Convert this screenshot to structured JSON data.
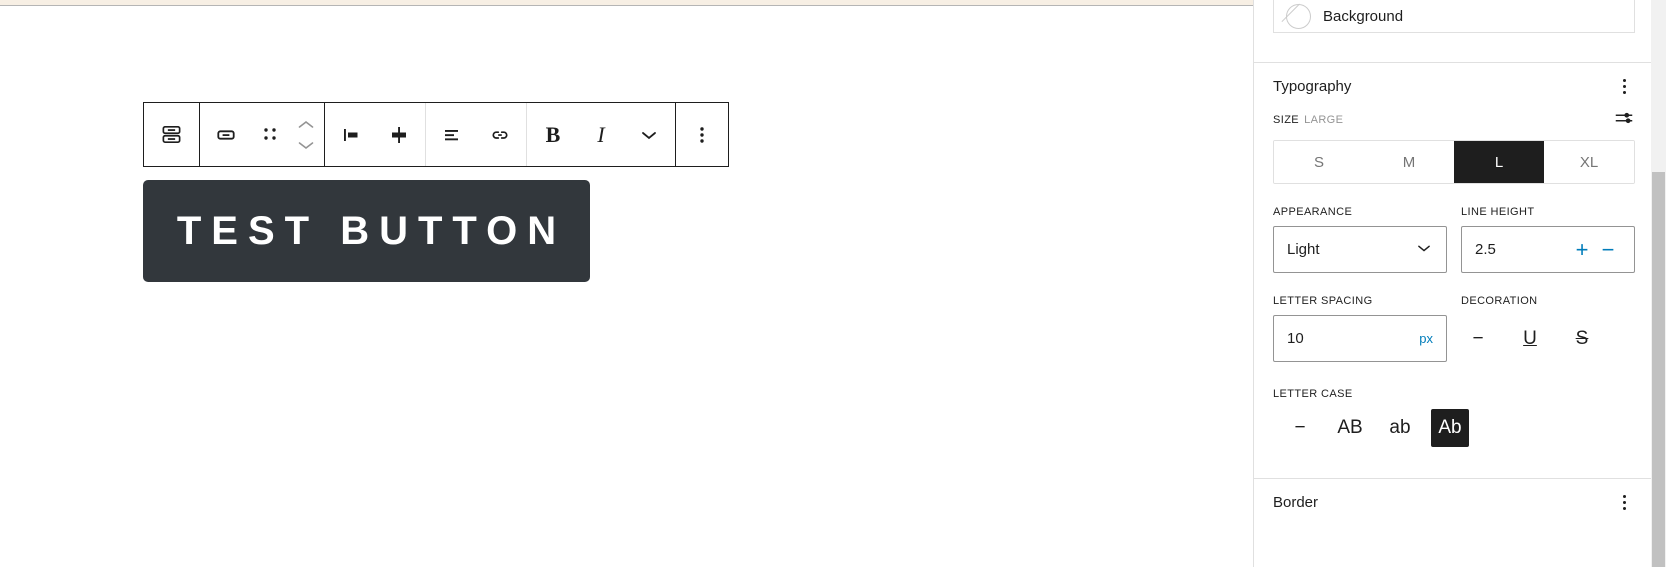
{
  "editor": {
    "block": {
      "text": "TEST BUTTON",
      "background_color": "#32373c",
      "text_color": "#ffffff"
    },
    "toolbar": {
      "block_type_switcher": "Button",
      "buttons": [
        {
          "name": "block-type-switcher",
          "icon": "button-block-icon",
          "label": "Button"
        },
        {
          "name": "select-parent-block",
          "icon": "buttons-block-icon",
          "label": "Select parent block: Buttons"
        },
        {
          "name": "drag-handle",
          "icon": "drag-handle-icon",
          "label": "Drag"
        },
        {
          "name": "move-up",
          "icon": "chevron-up-icon",
          "label": "Move up"
        },
        {
          "name": "move-down",
          "icon": "chevron-down-icon",
          "label": "Move down"
        },
        {
          "name": "align-left",
          "icon": "align-left-icon",
          "label": "Align"
        },
        {
          "name": "width-setting",
          "icon": "width-icon",
          "label": "Width"
        },
        {
          "name": "text-align",
          "icon": "text-align-icon",
          "label": "Align text"
        },
        {
          "name": "insert-link",
          "icon": "link-icon",
          "label": "Link"
        },
        {
          "name": "bold",
          "icon": "bold-icon",
          "label": "B"
        },
        {
          "name": "italic",
          "icon": "italic-icon",
          "label": "I"
        },
        {
          "name": "more-rich-text",
          "icon": "chevron-down-icon",
          "label": "More"
        },
        {
          "name": "block-options",
          "icon": "ellipsis-vertical-icon",
          "label": "Options"
        }
      ]
    }
  },
  "sidebar": {
    "background": {
      "label": "Background",
      "swatch": "none-swatch-icon"
    },
    "typography": {
      "title": "Typography",
      "options_icon": "ellipsis-vertical-icon",
      "size": {
        "label": "SIZE",
        "value_label": "LARGE",
        "custom_icon": "sliders-icon",
        "options": [
          {
            "label": "S",
            "active": false
          },
          {
            "label": "M",
            "active": false
          },
          {
            "label": "L",
            "active": true
          },
          {
            "label": "XL",
            "active": false
          }
        ]
      },
      "appearance": {
        "label": "APPEARANCE",
        "value": "Light",
        "chevron_icon": "chevron-down-icon"
      },
      "line_height": {
        "label": "LINE HEIGHT",
        "value": "2.5",
        "increment_label": "+",
        "decrement_label": "−"
      },
      "letter_spacing": {
        "label": "LETTER SPACING",
        "value": "10",
        "unit": "px"
      },
      "decoration": {
        "label": "DECORATION",
        "options": [
          {
            "name": "decoration-none",
            "glyph": "−",
            "icon": "dash-icon",
            "active": false
          },
          {
            "name": "decoration-underline",
            "glyph": "U",
            "icon": "underline-icon",
            "active": false
          },
          {
            "name": "decoration-strikethrough",
            "glyph": "S",
            "icon": "strikethrough-icon",
            "active": false
          }
        ]
      },
      "letter_case": {
        "label": "LETTER CASE",
        "options": [
          {
            "name": "letter-case-none",
            "glyph": "−",
            "icon": "dash-icon",
            "active": false
          },
          {
            "name": "letter-case-uppercase",
            "glyph": "AB",
            "icon": "uppercase-icon",
            "active": false
          },
          {
            "name": "letter-case-lowercase",
            "glyph": "ab",
            "icon": "lowercase-icon",
            "active": false
          },
          {
            "name": "letter-case-capitalize",
            "glyph": "Ab",
            "icon": "capitalize-icon",
            "active": true
          }
        ]
      }
    },
    "border": {
      "title": "Border",
      "options_icon": "ellipsis-vertical-icon"
    }
  },
  "colors": {
    "accent": "#007cba",
    "dark": "#1e1e1e",
    "muted": "#949494",
    "border": "#e0e0e0",
    "cream_strip": "#f7efe4",
    "scrollbar_thumb": "#c1c1c1"
  }
}
